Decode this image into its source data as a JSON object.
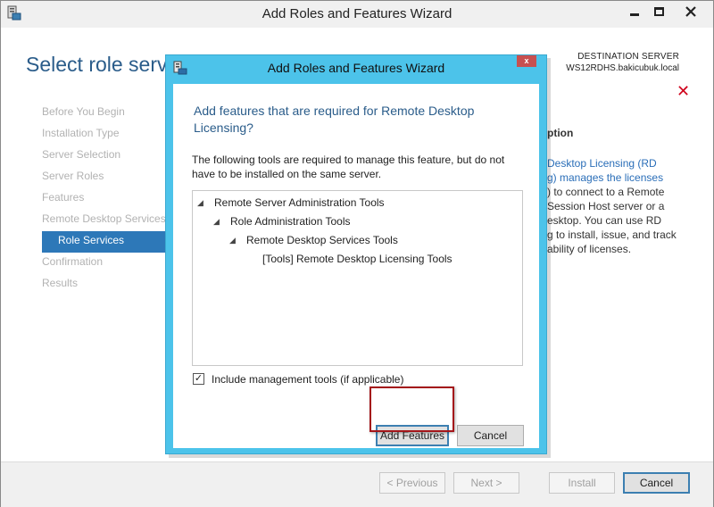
{
  "outer_window": {
    "title": "Add Roles and Features Wizard",
    "icon": "server-manager-icon",
    "controls": {
      "minimize": "minimize-icon",
      "maximize": "maximize-icon",
      "close": "close-icon"
    }
  },
  "page": {
    "heading": "Select role servi",
    "destination_label": "DESTINATION SERVER",
    "destination_server": "WS12RDHS.bakicubuk.local",
    "error_icon": "red-x-icon"
  },
  "nav": {
    "items": [
      {
        "label": "Before You Begin",
        "active": false
      },
      {
        "label": "Installation Type",
        "active": false
      },
      {
        "label": "Server Selection",
        "active": false
      },
      {
        "label": "Server Roles",
        "active": false
      },
      {
        "label": "Features",
        "active": false
      },
      {
        "label": "Remote Desktop Services",
        "active": false
      },
      {
        "label": "Role Services",
        "active": true
      },
      {
        "label": "Confirmation",
        "active": false
      },
      {
        "label": "Results",
        "active": false
      }
    ]
  },
  "description": {
    "title": "ption",
    "lines": [
      "Desktop Licensing (RD",
      "g) manages the licenses",
      ") to connect to a Remote",
      "Session Host server or a",
      "esktop. You can use RD",
      "g to install, issue, and track",
      "ability of licenses."
    ]
  },
  "footer": {
    "previous": "< Previous",
    "next": "Next >",
    "install": "Install",
    "cancel": "Cancel"
  },
  "dialog": {
    "title": "Add Roles and Features Wizard",
    "close_glyph": "x",
    "heading": "Add features that are required for Remote Desktop Licensing?",
    "description": "The following tools are required to manage this feature, but do not have to be installed on the same server.",
    "tree": [
      {
        "label": "Remote Server Administration Tools",
        "expanded": true
      },
      {
        "label": "Role Administration Tools",
        "expanded": true
      },
      {
        "label": "Remote Desktop Services Tools",
        "expanded": true
      },
      {
        "label": "[Tools] Remote Desktop Licensing Tools",
        "expanded": false
      }
    ],
    "include_tools_label": "Include management tools (if applicable)",
    "include_tools_checked": true,
    "add_features_button": "Add Features",
    "cancel_button": "Cancel"
  }
}
